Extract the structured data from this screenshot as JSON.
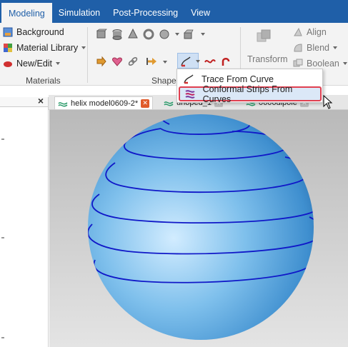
{
  "menubar": {
    "tabs": [
      {
        "label": "Modeling",
        "active": true
      },
      {
        "label": "Simulation"
      },
      {
        "label": "Post-Processing"
      },
      {
        "label": "View"
      }
    ]
  },
  "ribbon": {
    "materials": {
      "background": "Background",
      "library": "Material Library",
      "new_edit": "New/Edit",
      "group_label": "Materials"
    },
    "shapes": {
      "group_label": "Shapes"
    },
    "transform": {
      "transform": "Transform",
      "align": "Align",
      "blend": "Blend",
      "boolean": "Boolean"
    }
  },
  "dropdown": {
    "items": [
      {
        "label": "Trace From Curve"
      },
      {
        "label": "Conformal Strips From Curves",
        "highlighted": true
      }
    ]
  },
  "doc_tabs": [
    {
      "label": "helix model0609-2*",
      "active": true
    },
    {
      "label": "unoped_1"
    },
    {
      "label": "0606dipole"
    }
  ],
  "colors": {
    "accent": "#1f5fa8",
    "highlight_border": "#e04050",
    "sphere": "#6fb4e6",
    "helix": "#1018c8"
  }
}
